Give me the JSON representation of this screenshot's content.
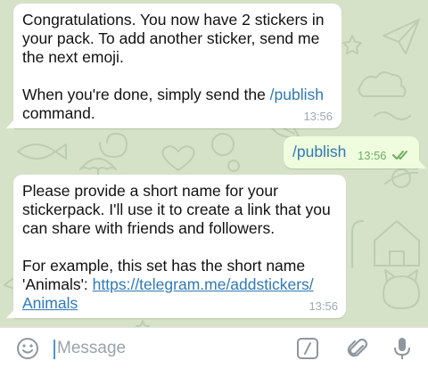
{
  "messages": [
    {
      "direction": "incoming",
      "lines": [
        "Congratulations. You now have 2 stickers in",
        "your pack. To add another sticker, send me",
        "the next emoji."
      ],
      "line2_prefix": "When you're done, simply send the ",
      "line2_cmd": "/publish",
      "line3": "command.",
      "time": "13:56"
    },
    {
      "direction": "outgoing",
      "text": "/publish",
      "time": "13:56",
      "status_icon": "double-check-icon"
    },
    {
      "direction": "incoming",
      "lines": [
        "Please provide a short name for your",
        "stickerpack. I'll use it to create a link that you",
        "can share with friends and followers."
      ],
      "example_prefix": "For example, this set has the short name",
      "example_label": "'Animals': ",
      "link_part1": "https://telegram.me/addstickers/",
      "link_part2": "Animals",
      "time": "13:56"
    }
  ],
  "composer": {
    "placeholder": "Message",
    "icons": [
      "emoji-icon",
      "bot-command-icon",
      "attach-icon",
      "microphone-icon"
    ]
  },
  "colors": {
    "chat_background": "#d6e2c8",
    "incoming_bubble": "#ffffff",
    "outgoing_bubble": "#effdde",
    "link": "#2e79b6",
    "read_check": "#6cae5e"
  }
}
